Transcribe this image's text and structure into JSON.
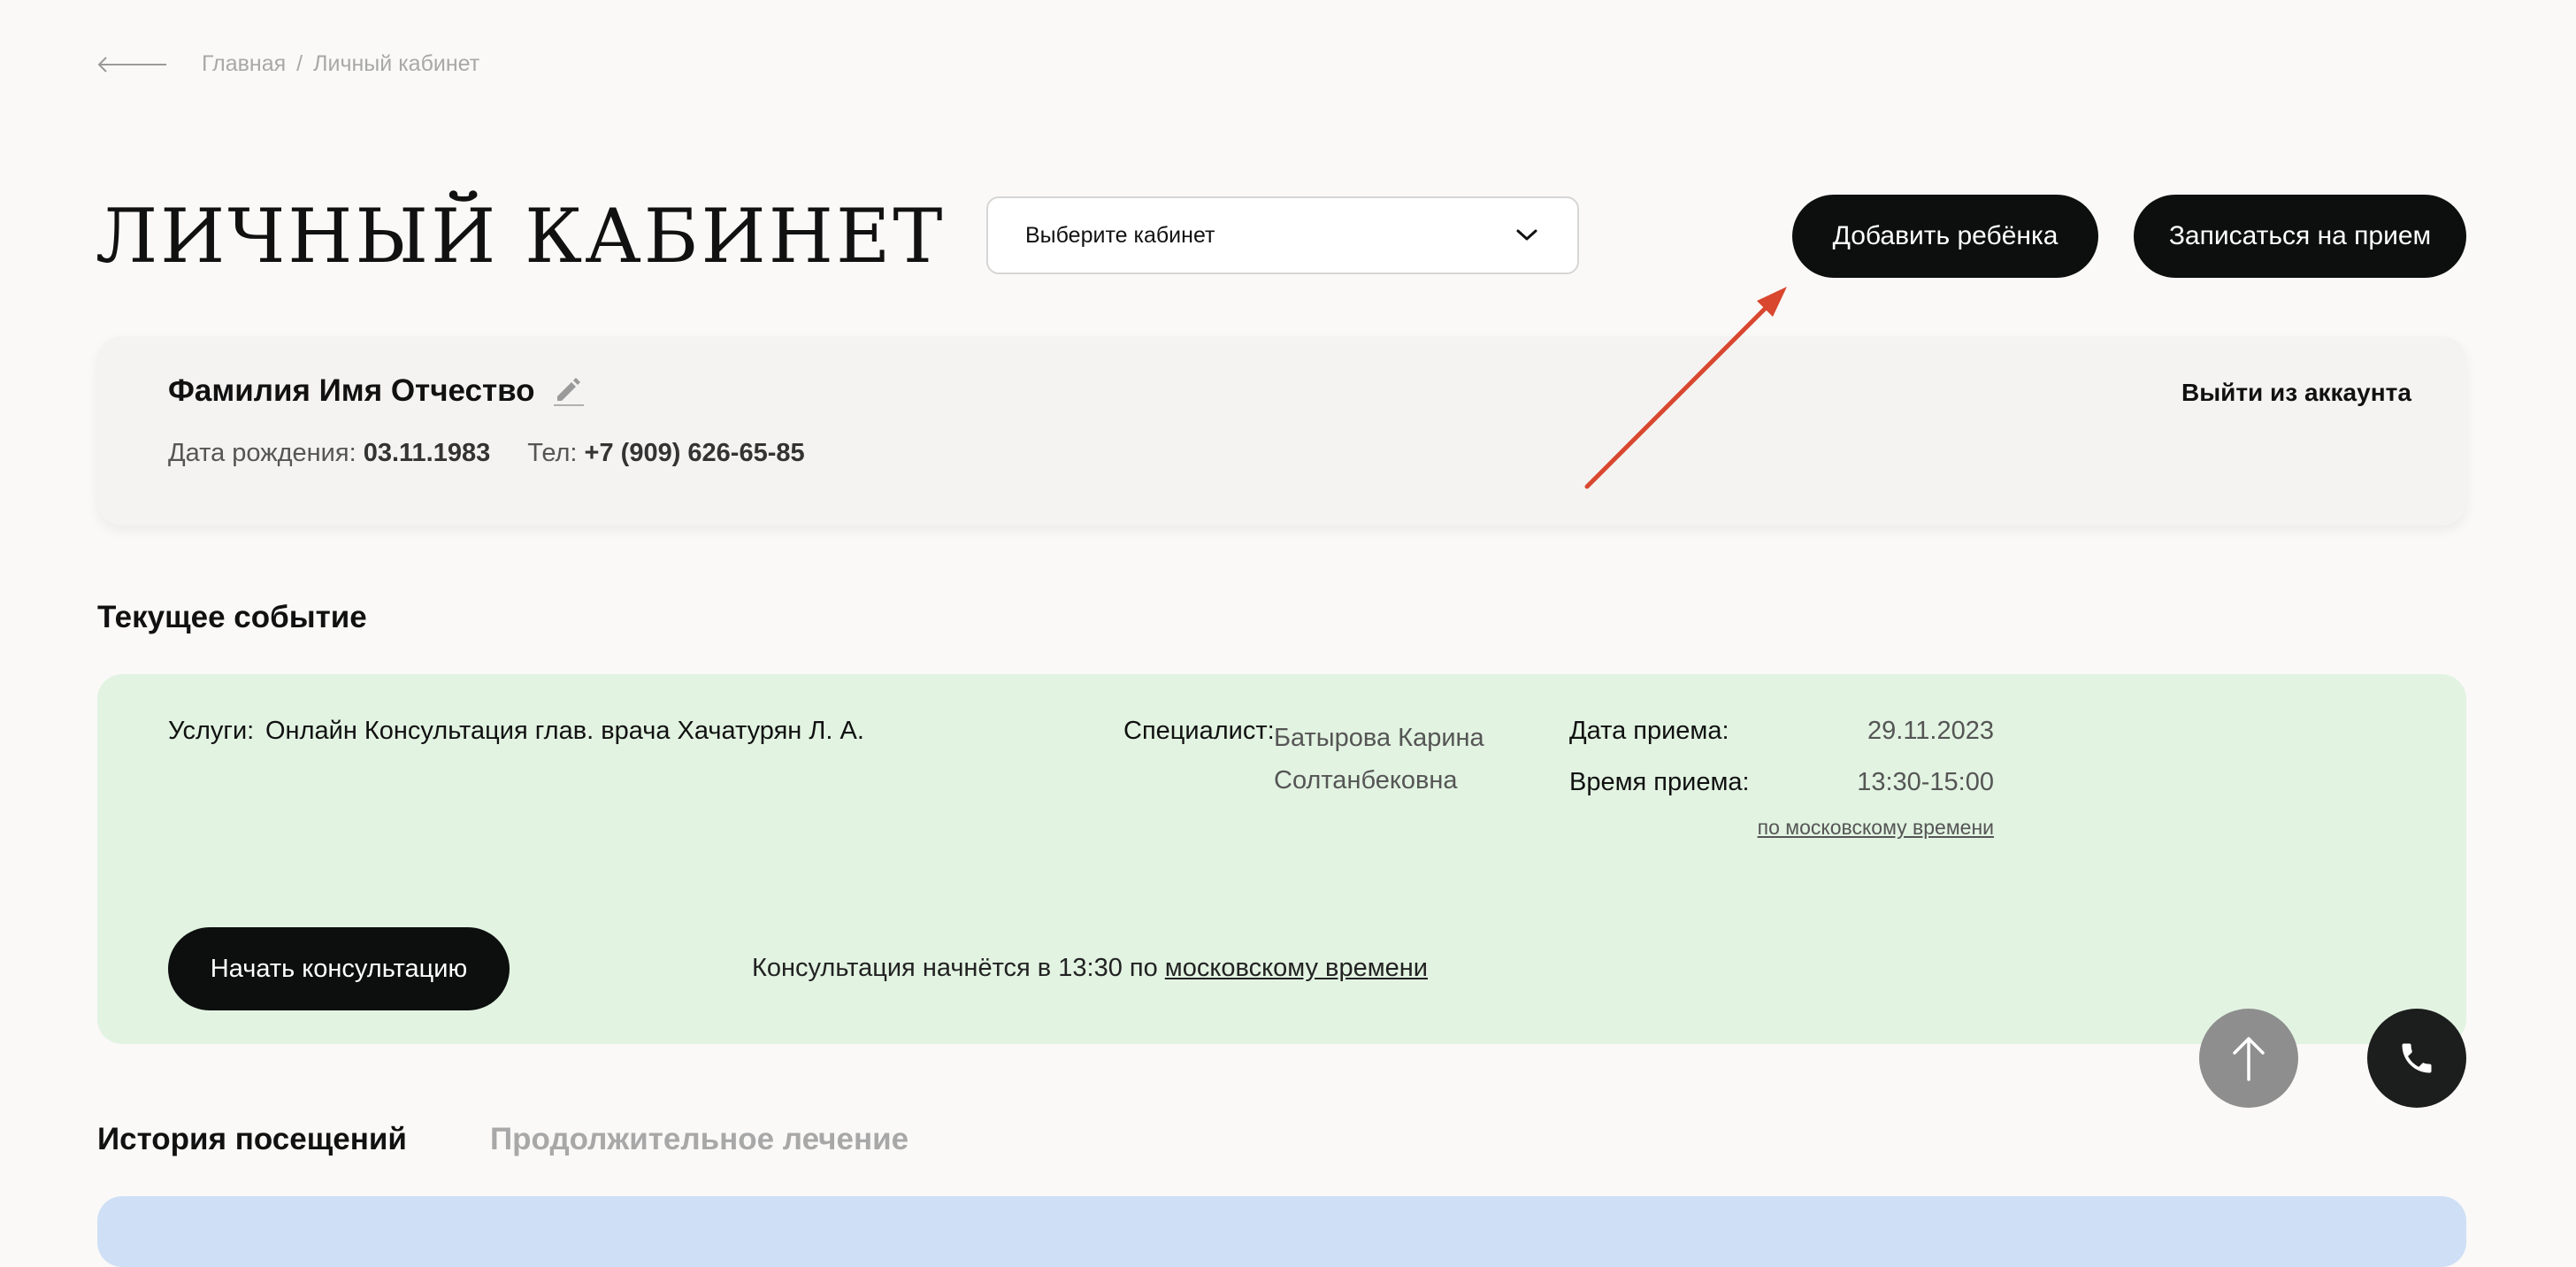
{
  "breadcrumb": {
    "home": "Главная",
    "separator": "/",
    "current": "Личный кабинет"
  },
  "page_title": "ЛИЧНЫЙ КАБИНЕТ",
  "cabinet_select": {
    "value": "Выберите кабинет"
  },
  "header_buttons": {
    "add_child": "Добавить ребёнка",
    "book": "Записаться на прием"
  },
  "profile": {
    "full_name": "Фамилия Имя Отчество",
    "logout": "Выйти из аккаунта",
    "birth_label": "Дата рождения:",
    "birth_value": "03.11.1983",
    "phone_label": "Тел:",
    "phone_value": "+7 (909) 626-65-85"
  },
  "current_event": {
    "section_title": "Текущее событие",
    "services_label": "Услуги:",
    "services_value": "Онлайн Консультация глав. врача Хачатурян Л. А.",
    "specialist_label": "Специалист:",
    "specialist_value": "Батырова Карина Солтанбековна",
    "date_label": "Дата приема:",
    "date_value": "29.11.2023",
    "time_label": "Время приема:",
    "time_value": "13:30-15:00",
    "timezone_link": "по московскому времени",
    "start_button": "Начать консультацию",
    "start_note": "Консультация начнётся в 13:30 по",
    "start_note_link": "московскому времени"
  },
  "tabs": {
    "history": "История посещений",
    "long_treatment": "Продолжительное лечение"
  },
  "colors": {
    "event_card": "#e2f3e2",
    "history_card": "#cfdff5",
    "primary_button": "#0c0f0e",
    "annotation_arrow": "#d9472f"
  },
  "icons": {
    "back": "back-arrow-icon",
    "select": "chevron-down-icon",
    "edit": "pencil-icon",
    "scroll_up": "arrow-up-icon",
    "call": "phone-icon"
  }
}
